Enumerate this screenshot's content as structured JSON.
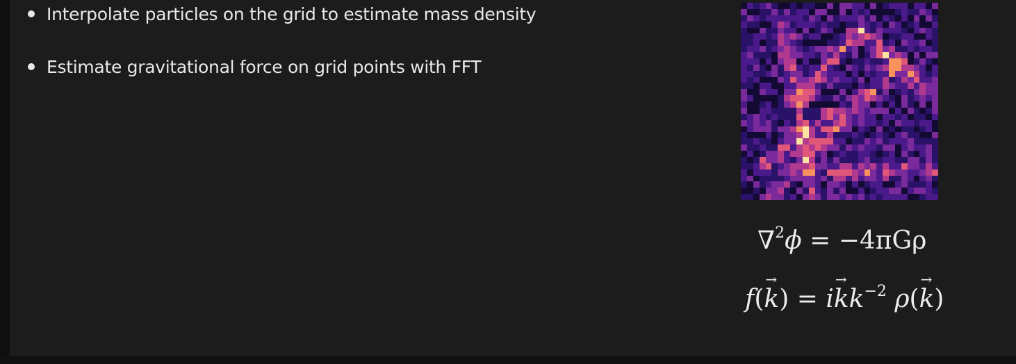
{
  "bullets": [
    {
      "text": "Interpolate particles on the grid to estimate mass density"
    },
    {
      "text": "Estimate gravitational force on grid points with FFT"
    }
  ],
  "equations": {
    "poisson": {
      "nabla": "∇",
      "power": "2",
      "phi": "ϕ",
      "rhs": " = −4πGρ"
    },
    "force": {
      "f": "f",
      "k": "k",
      "i": "i",
      "exp": "−2",
      "rho": "ρ"
    }
  },
  "colors": {
    "background": "#1c1c1c",
    "text": "#e8e8e8",
    "colormap": [
      "#120a33",
      "#2a1268",
      "#4a1a8a",
      "#7b2a9b",
      "#b23a8e",
      "#e0577a",
      "#f8935f",
      "#fde3a0"
    ]
  }
}
